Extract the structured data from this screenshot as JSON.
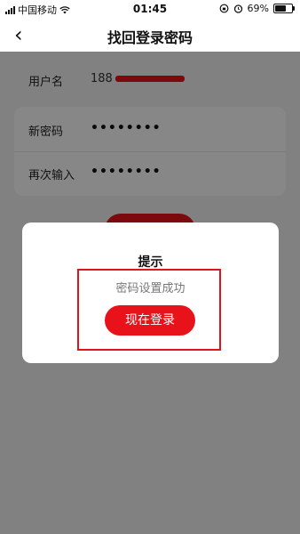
{
  "status_bar": {
    "carrier": "中国移动",
    "time": "01:45",
    "battery_percent": "69%",
    "battery_level": 0.69,
    "icons": [
      "signal-icon",
      "wifi-icon",
      "rotation-lock-icon",
      "alarm-icon",
      "battery-icon"
    ]
  },
  "nav": {
    "back_icon": "‹",
    "title": "找回登录密码"
  },
  "form": {
    "username_label": "用户名",
    "username_value": "188",
    "new_password_label": "新密码",
    "new_password_value": "••••••••",
    "confirm_password_label": "再次输入",
    "confirm_password_value": "••••••••"
  },
  "dialog": {
    "title": "提示",
    "message": "密码设置成功",
    "button_label": "现在登录"
  },
  "colors": {
    "accent": "#e8121b",
    "highlight_border": "#e0141c",
    "overlay": "rgba(0,0,0,0.47)"
  }
}
